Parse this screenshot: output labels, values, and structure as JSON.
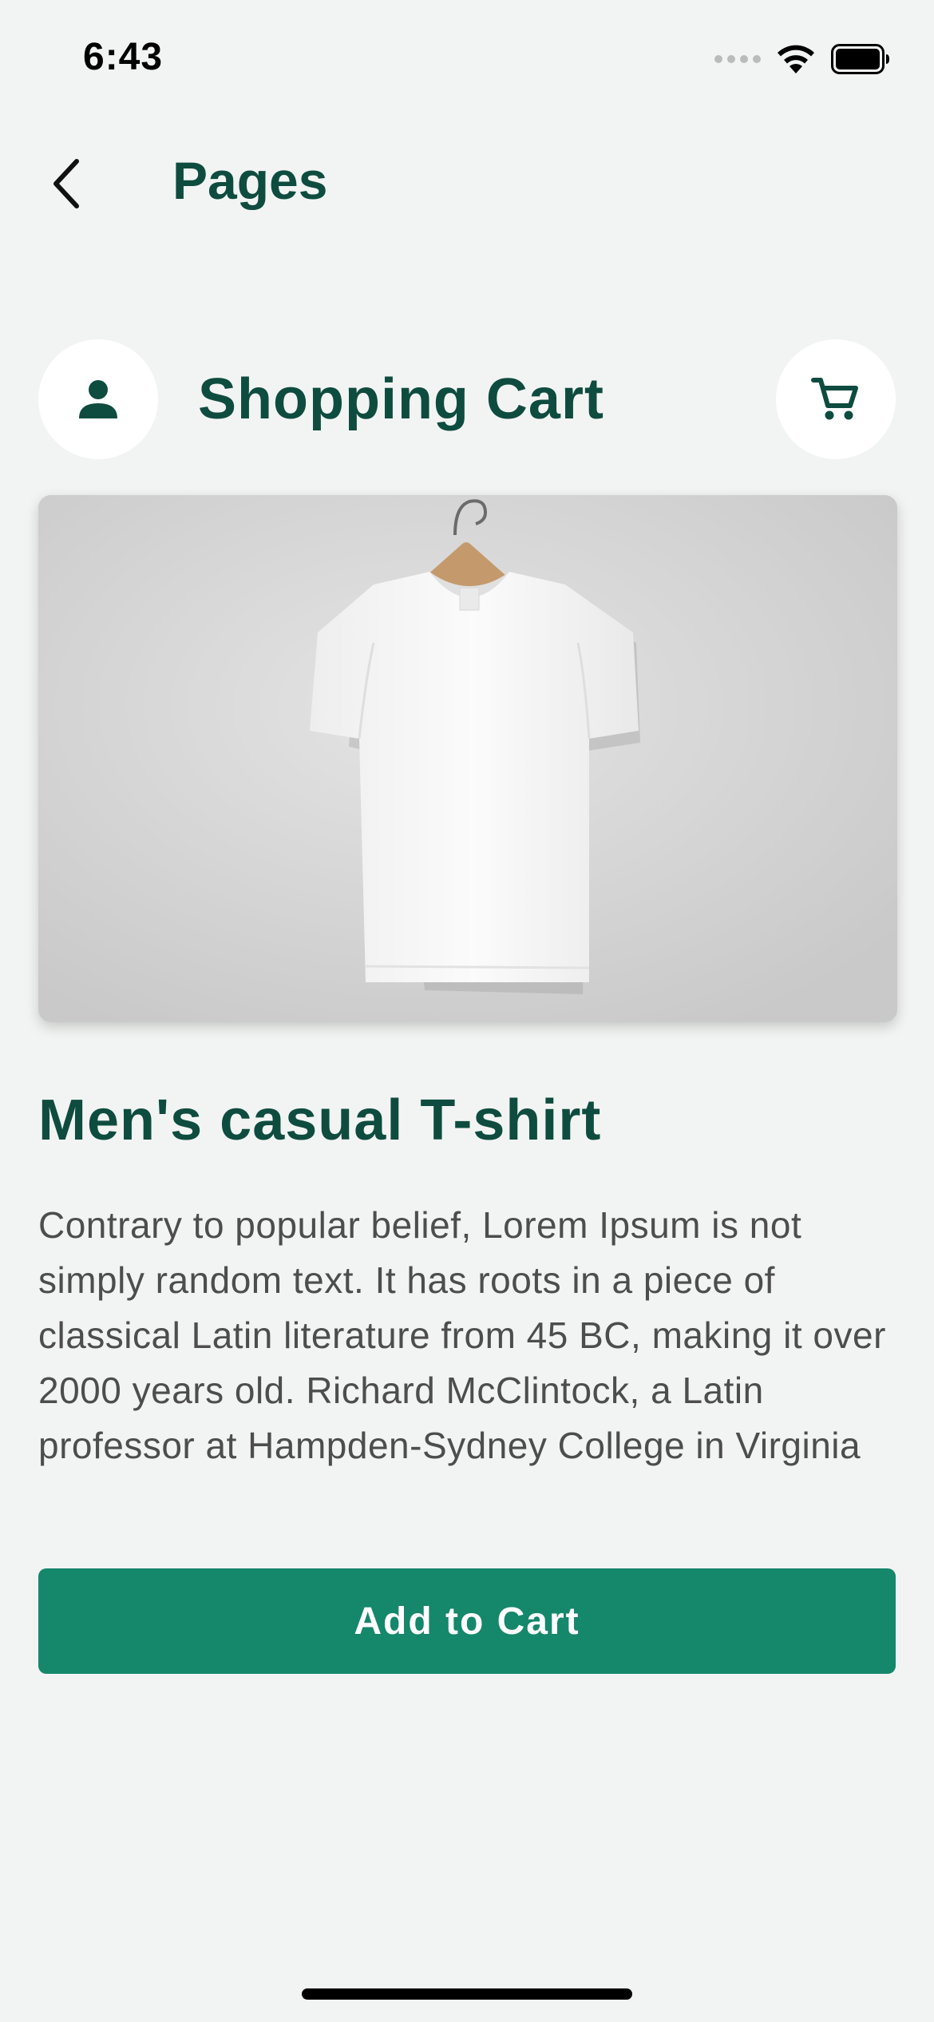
{
  "status_bar": {
    "time": "6:43",
    "icons": [
      "signal-icon",
      "wifi-icon",
      "battery-icon"
    ]
  },
  "nav": {
    "back_icon": "chevron-left-icon",
    "title": "Pages"
  },
  "header": {
    "left_icon": "person-icon",
    "title": "Shopping Cart",
    "right_icon": "cart-icon"
  },
  "product": {
    "image_subject": "white t-shirt on hanger",
    "title": "Men's casual T-shirt",
    "description": "Contrary to popular belief, Lorem Ipsum is not simply random text. It has roots in a piece of classical Latin literature from 45 BC, making it over 2000 years old. Richard McClintock, a Latin professor at Hampden-Sydney College in Virginia",
    "add_to_cart_label": "Add to Cart"
  },
  "colors": {
    "background": "#f2f4f3",
    "brand_dark": "#0e4c3f",
    "button": "#15876b",
    "text_body": "#4d4d4d"
  }
}
